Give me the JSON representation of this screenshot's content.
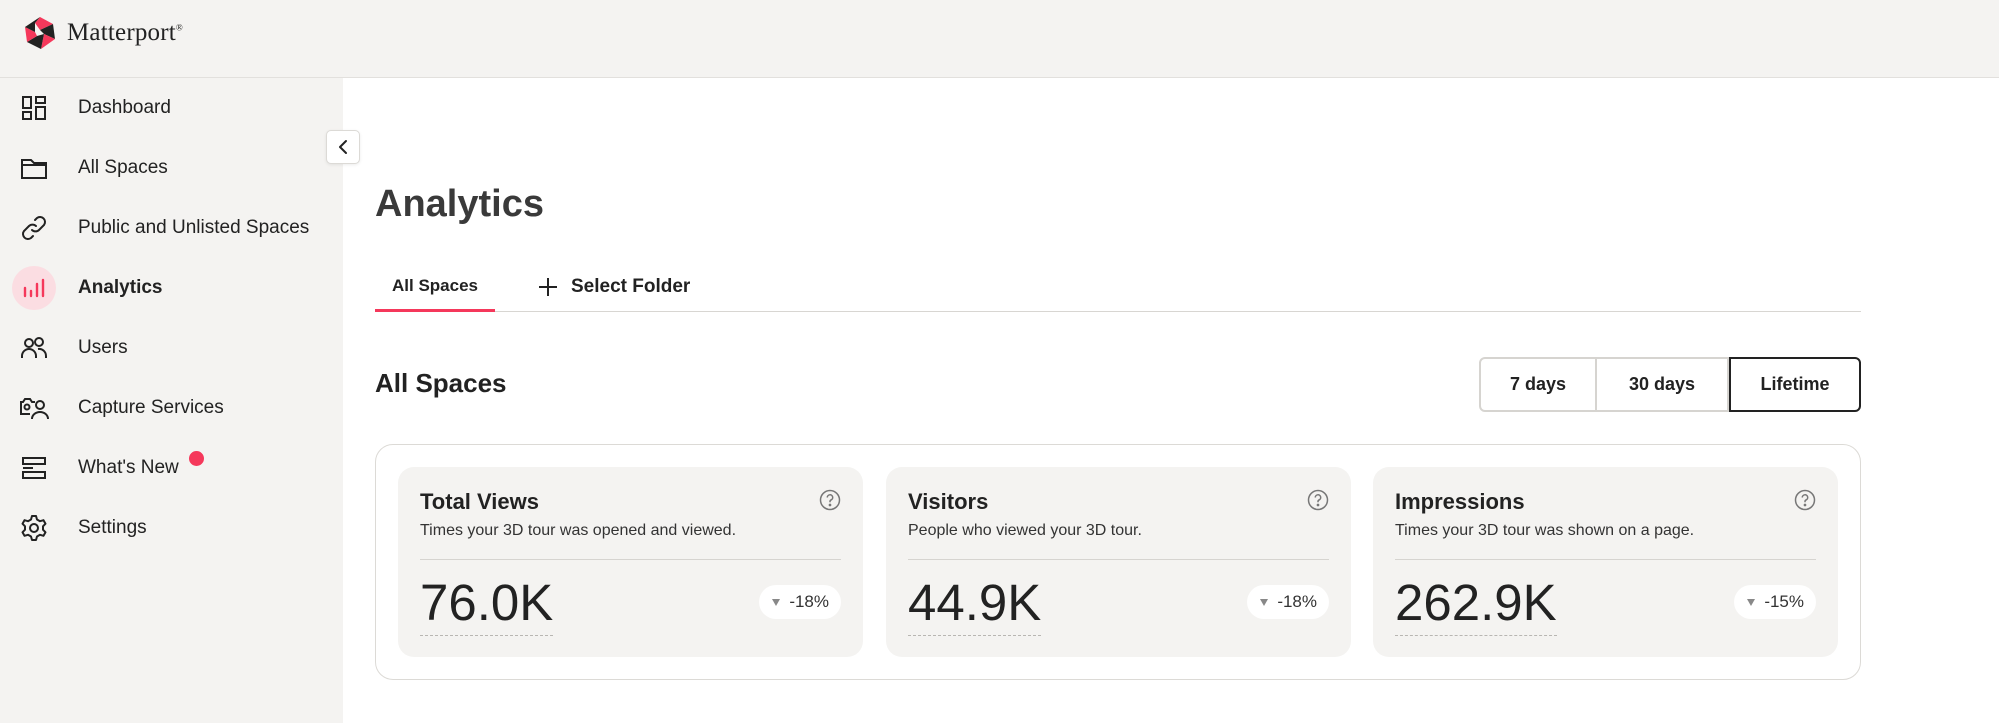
{
  "brand": {
    "name": "Matterport",
    "registered": "®"
  },
  "sidebar": {
    "items": [
      {
        "label": "Dashboard",
        "icon": "dashboard-icon"
      },
      {
        "label": "All Spaces",
        "icon": "folder-icon"
      },
      {
        "label": "Public and Unlisted Spaces",
        "icon": "link-icon"
      },
      {
        "label": "Analytics",
        "icon": "analytics-icon",
        "active": true
      },
      {
        "label": "Users",
        "icon": "users-icon"
      },
      {
        "label": "Capture Services",
        "icon": "capture-services-icon"
      },
      {
        "label": "What's New",
        "icon": "whats-new-icon",
        "badge_dot": true
      },
      {
        "label": "Settings",
        "icon": "gear-icon"
      }
    ]
  },
  "main": {
    "title": "Analytics",
    "tabs": [
      {
        "label": "All Spaces",
        "active": true
      },
      {
        "label": "Select Folder",
        "icon": "plus-icon"
      }
    ],
    "section_title": "All Spaces",
    "time_ranges": [
      {
        "label": "7 days"
      },
      {
        "label": "30 days"
      },
      {
        "label": "Lifetime",
        "selected": true
      }
    ],
    "cards": [
      {
        "title": "Total Views",
        "description": "Times your 3D tour was opened and viewed.",
        "value": "76.0K",
        "change": "-18%"
      },
      {
        "title": "Visitors",
        "description": "People who viewed your 3D tour.",
        "value": "44.9K",
        "change": "-18%"
      },
      {
        "title": "Impressions",
        "description": "Times your 3D tour was shown on a page.",
        "value": "262.9K",
        "change": "-15%"
      }
    ]
  },
  "colors": {
    "accent": "#f5385b",
    "sidebar_bg": "#f4f3f1",
    "card_bg": "#f4f3f1",
    "active_icon_bg": "#fbdde2"
  }
}
